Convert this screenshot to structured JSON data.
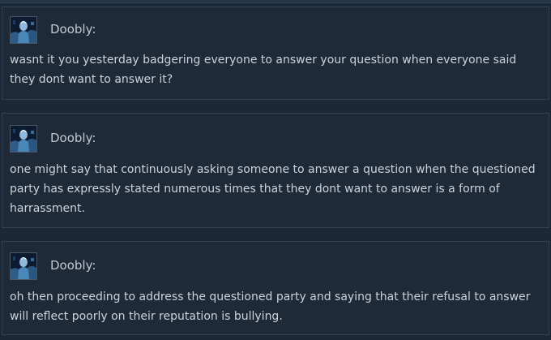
{
  "comments": [
    {
      "author": "Doobly:",
      "text": "wasnt it you yesterday badgering everyone to answer your question when everyone said they dont want to answer it?"
    },
    {
      "author": "Doobly:",
      "text": "one might say that continuously asking someone to answer a question when the questioned party has expressly stated numerous times that they dont want to answer is a form of harrassment."
    },
    {
      "author": "Doobly:",
      "text": "oh then proceeding to address the questioned party and saying that their refusal to answer will reflect poorly on their reputation is bullying."
    }
  ],
  "avatar_icon": "user-avatar-icon",
  "colors": {
    "background": "#1b2838",
    "panel": "#1e2a38",
    "border": "#324153",
    "text": "#ccd2d9"
  }
}
